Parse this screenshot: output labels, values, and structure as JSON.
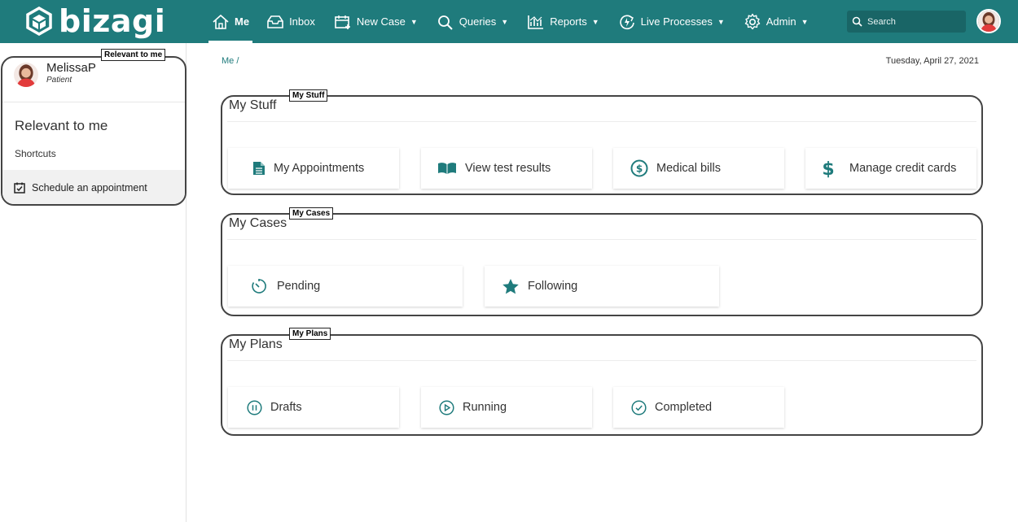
{
  "brand": {
    "name": "bizagi"
  },
  "nav": {
    "me": "Me",
    "inbox": "Inbox",
    "new_case": "New Case",
    "queries": "Queries",
    "reports": "Reports",
    "live_processes": "Live Processes",
    "admin": "Admin"
  },
  "search": {
    "placeholder": "Search"
  },
  "sidebar": {
    "user_name": "MelissaP",
    "user_role": "Patient",
    "heading": "Relevant to me",
    "shortcuts_label": "Shortcuts",
    "items": [
      {
        "label": "Schedule an appointment",
        "icon": "calendar-check-icon"
      }
    ],
    "annotation": "Relevant to me"
  },
  "breadcrumb": "Me /",
  "date": "Tuesday, April 27, 2021",
  "sections": {
    "my_stuff": {
      "title": "My Stuff",
      "annotation": "My Stuff",
      "cards": [
        {
          "label": "My Appointments",
          "icon": "document-icon"
        },
        {
          "label": "View test results",
          "icon": "open-book-icon"
        },
        {
          "label": "Medical bills",
          "icon": "dollar-circle-icon"
        },
        {
          "label": "Manage credit cards",
          "icon": "dollar-sign-icon"
        }
      ]
    },
    "my_cases": {
      "title": "My Cases",
      "annotation": "My Cases",
      "cards": [
        {
          "label": "Pending",
          "icon": "timer-icon"
        },
        {
          "label": "Following",
          "icon": "star-icon"
        }
      ]
    },
    "my_plans": {
      "title": "My Plans",
      "annotation": "My Plans",
      "cards": [
        {
          "label": "Drafts",
          "icon": "pause-circle-icon"
        },
        {
          "label": "Running",
          "icon": "play-circle-icon"
        },
        {
          "label": "Completed",
          "icon": "check-circle-icon"
        }
      ]
    }
  },
  "colors": {
    "brand": "#1f7b7c",
    "search_bg": "#196566",
    "text": "#333333"
  }
}
